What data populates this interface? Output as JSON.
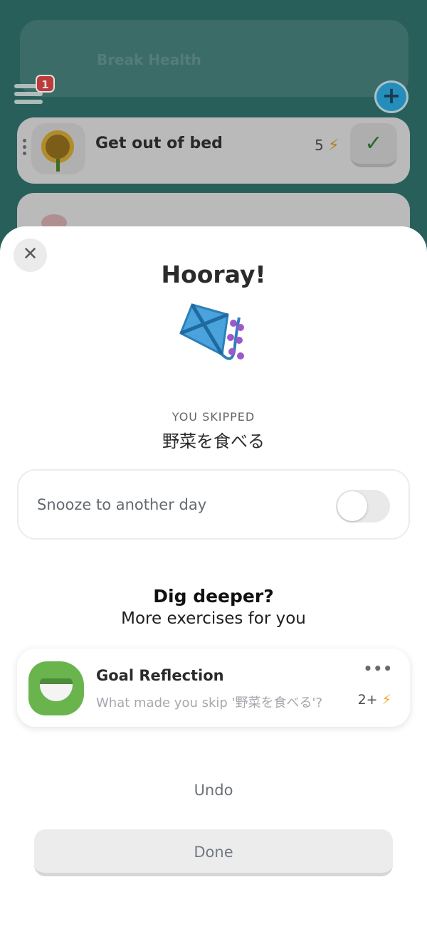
{
  "background": {
    "top_card_text": "Break Health",
    "notification_count": "1",
    "habit": {
      "title": "Get out of bed",
      "points": "5"
    }
  },
  "modal": {
    "title": "Hooray!",
    "skipped_label": "YOU SKIPPED",
    "skipped_name": "野菜を食べる",
    "snooze": {
      "label": "Snooze to another day",
      "enabled": false
    },
    "dig_title": "Dig deeper?",
    "dig_subtitle": "More exercises for you",
    "exercise": {
      "title": "Goal Reflection",
      "subtitle": "What made you skip '野菜を食べる'?",
      "points": "2+"
    },
    "undo_label": "Undo",
    "done_label": "Done"
  },
  "colors": {
    "background": "#2f6d68",
    "bolt": "#f0a72a",
    "exercise_icon": "#6ab44d",
    "kite": "#3f9ad6",
    "badge": "#d94444"
  },
  "icons": [
    "menu-icon",
    "add-icon",
    "sunflower-icon",
    "check-icon",
    "close-icon",
    "kite-icon",
    "salad-icon",
    "more-icon",
    "bolt-icon"
  ]
}
